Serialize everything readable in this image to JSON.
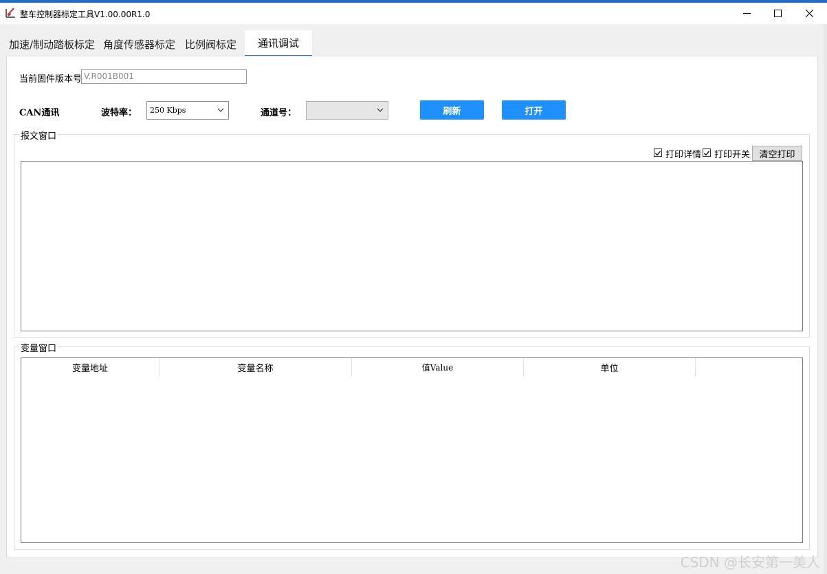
{
  "window": {
    "title": "整车控制器标定工具V1.00.00R1.0",
    "minimize_glyph": "—",
    "maximize_glyph": "☐",
    "close_glyph": "✕",
    "accent_color": "#1e6fc9"
  },
  "tabs": [
    {
      "label": "加速/制动踏板标定",
      "active": false
    },
    {
      "label": "角度传感器标定",
      "active": false
    },
    {
      "label": "比例阀标定",
      "active": false
    },
    {
      "label": "通讯调试",
      "active": true
    }
  ],
  "firmware": {
    "label": "当前固件版本号",
    "value": "V.R001B001"
  },
  "can": {
    "section_label": "CAN通讯",
    "baud_label": "波特率：",
    "baud_value": "250 Kbps",
    "channel_label": "通道号：",
    "channel_value": "",
    "refresh_label": "刷新",
    "open_label": "打开",
    "button_color": "#1e90ff"
  },
  "message_window": {
    "title": "报文窗口",
    "print_detail_label": "打印详情",
    "print_detail_checked": true,
    "print_switch_label": "打印开关",
    "print_switch_checked": true,
    "clear_label": "清空打印"
  },
  "variable_window": {
    "title": "变量窗口",
    "columns": [
      "变量地址",
      "变量名称",
      "值Value",
      "单位",
      ""
    ]
  },
  "watermark": "CSDN @长安第一美人"
}
